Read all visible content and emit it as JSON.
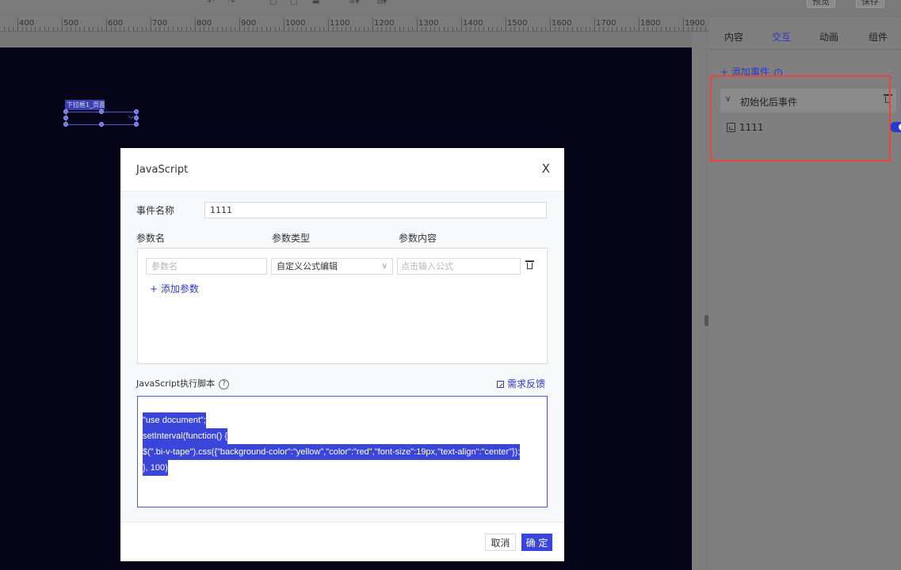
{
  "toolbar": {
    "preview_label": "预览",
    "save_label": "保存"
  },
  "ruler": {
    "ticks": [
      "400",
      "500",
      "600",
      "700",
      "800",
      "900",
      "1000",
      "1100",
      "1200",
      "1300",
      "1400",
      "1500",
      "1600",
      "1700",
      "1800",
      "1900"
    ]
  },
  "canvas": {
    "widget_label": "下拉框1_页面1",
    "background_color": "#07051a"
  },
  "right_panel": {
    "tabs": [
      {
        "label": "内容",
        "active": false
      },
      {
        "label": "交互",
        "active": true
      },
      {
        "label": "动画",
        "active": false
      },
      {
        "label": "组件",
        "active": false
      }
    ],
    "add_event_label": "+ 添加事件",
    "event_group_title": "初始化后事件",
    "event_item_label": "1111",
    "event_item_enabled": true
  },
  "dialog": {
    "title": "JavaScript",
    "close_label": "X",
    "event_name_label": "事件名称",
    "event_name_value": "1111",
    "param_headers": {
      "name": "参数名",
      "type": "参数类型",
      "content": "参数内容"
    },
    "param_row": {
      "name_placeholder": "参数名",
      "type_value": "自定义公式编辑",
      "content_placeholder": "点击输入公式"
    },
    "add_param_label": "+ 添加参数",
    "script_label": "JavaScript执行脚本",
    "feedback_label": "需求反馈",
    "script_lines": [
      "\"use document\";",
      "setInterval(function() {",
      "$(\".bi-v-tape\").css({\"background-color\":\"yellow\",\"color\":\"red\",\"font-size\":19px,\"text-align\":\"center\"});",
      "}, 100)"
    ],
    "cancel_label": "取消",
    "confirm_label": "确 定"
  },
  "colors": {
    "accent": "#3a45d9",
    "highlight_border": "#e8453c"
  }
}
